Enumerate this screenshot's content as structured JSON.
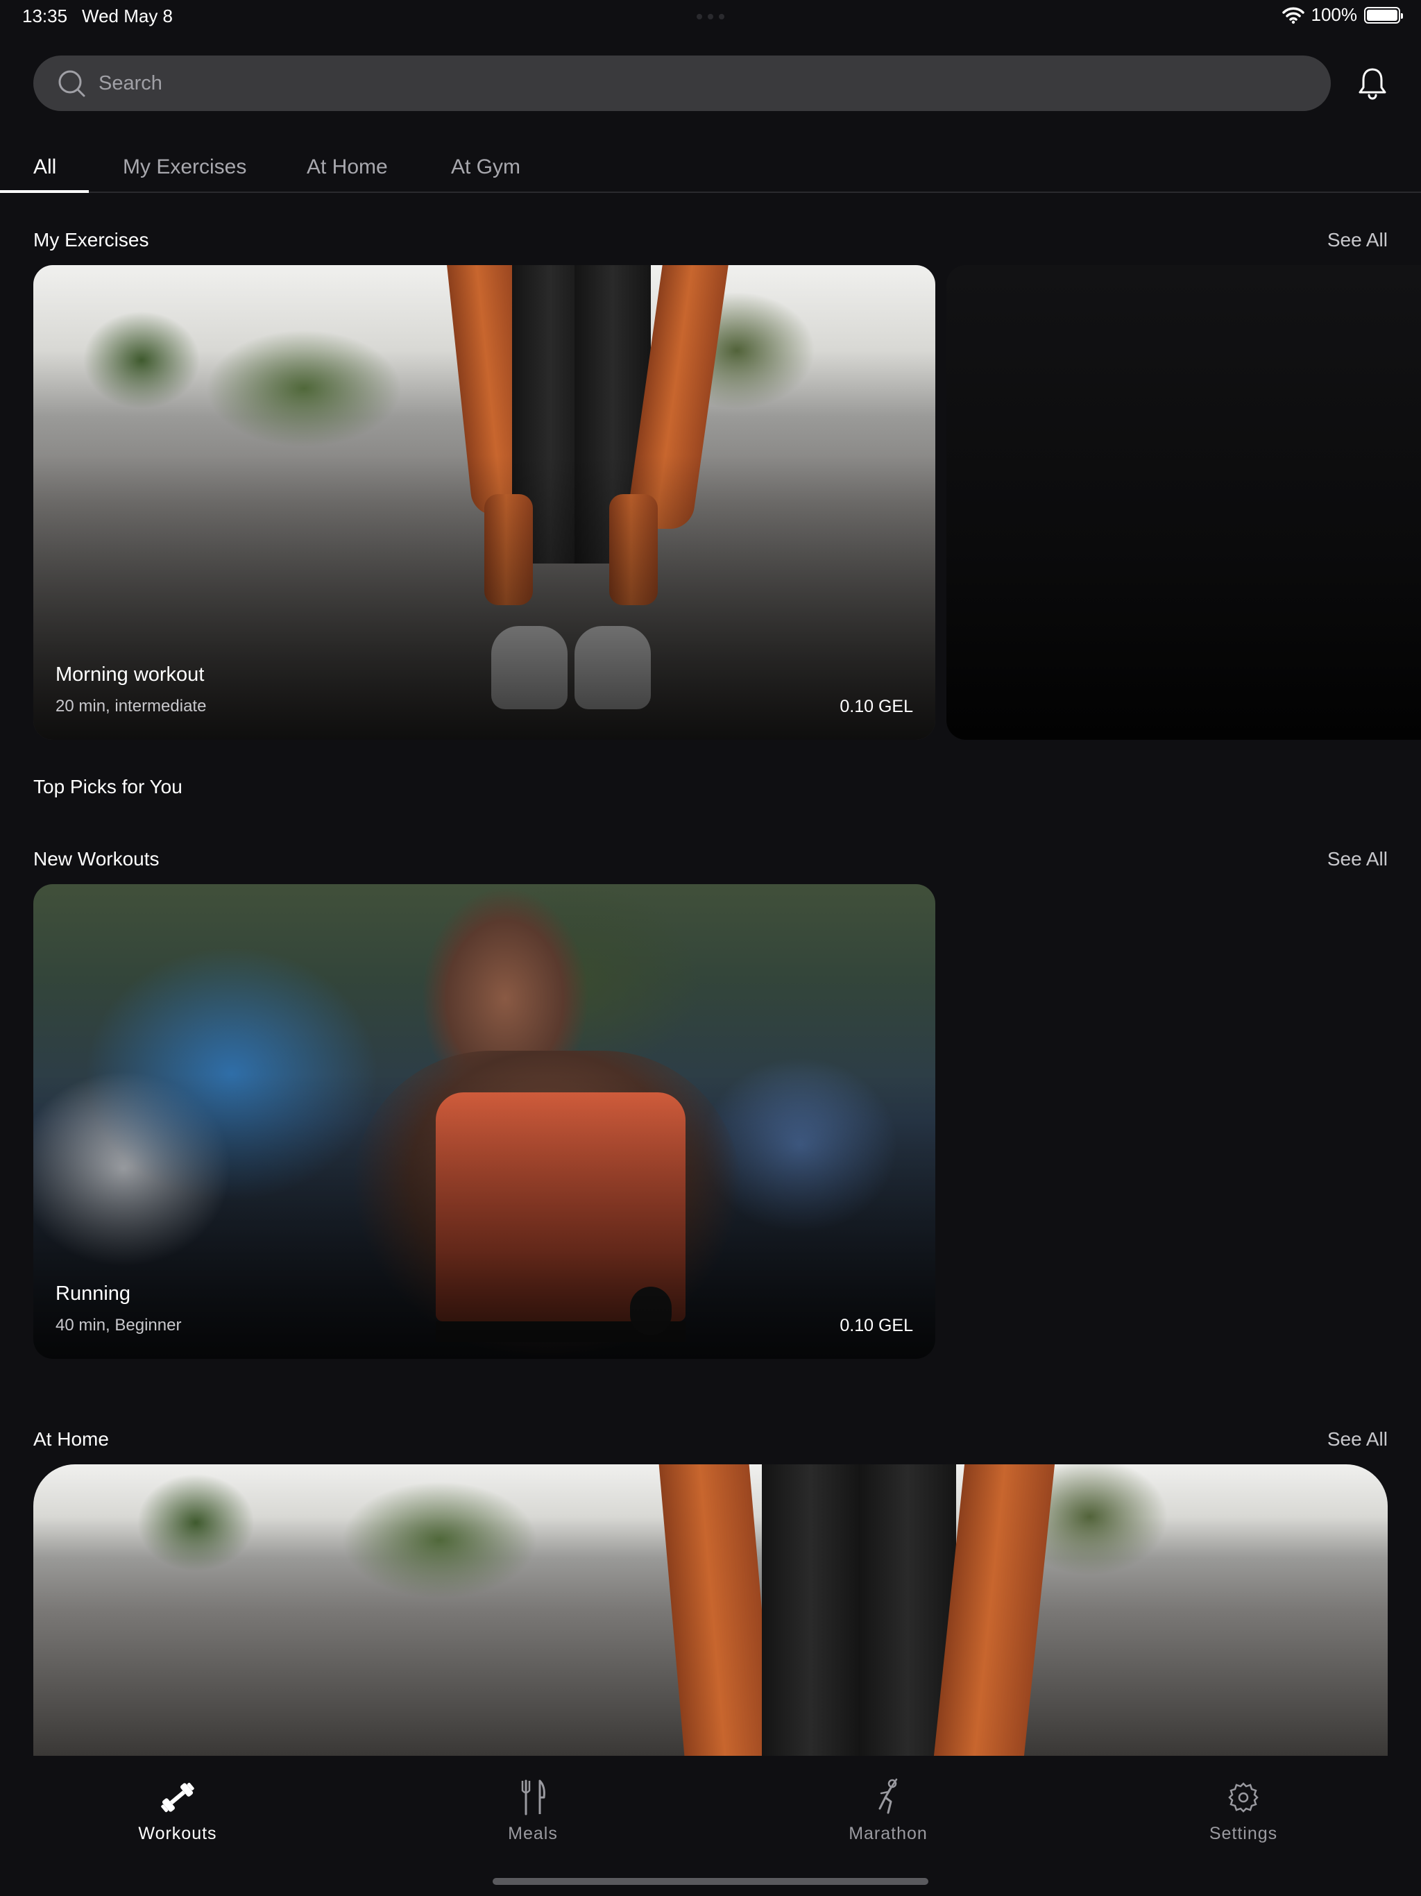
{
  "status_bar": {
    "time": "13:35",
    "date": "Wed May 8",
    "battery": "100%"
  },
  "search": {
    "placeholder": "Search"
  },
  "tabs": [
    {
      "label": "All",
      "active": true
    },
    {
      "label": "My Exercises",
      "active": false
    },
    {
      "label": "At Home",
      "active": false
    },
    {
      "label": "At Gym",
      "active": false
    }
  ],
  "sections": {
    "my_exercises": {
      "title": "My Exercises",
      "see_all": "See All",
      "card": {
        "title": "Morning workout",
        "subtitle": "20 min, intermediate",
        "price": "0.10 GEL"
      }
    },
    "top_picks": {
      "title": "Top Picks for You"
    },
    "new_workouts": {
      "title": "New Workouts",
      "see_all": "See All",
      "card": {
        "title": "Running",
        "subtitle": "40 min, Beginner",
        "price": "0.10 GEL"
      }
    },
    "at_home": {
      "title": "At Home",
      "see_all": "See All"
    }
  },
  "tabbar": [
    {
      "label": "Workouts",
      "icon": "dumbbell-icon",
      "active": true
    },
    {
      "label": "Meals",
      "icon": "fork-knife-icon",
      "active": false
    },
    {
      "label": "Marathon",
      "icon": "runner-icon",
      "active": false
    },
    {
      "label": "Settings",
      "icon": "gear-icon",
      "active": false
    }
  ],
  "colors": {
    "background": "#0f0f12",
    "search_field": "#3a3a3d",
    "muted_text": "#a8a8ae"
  }
}
